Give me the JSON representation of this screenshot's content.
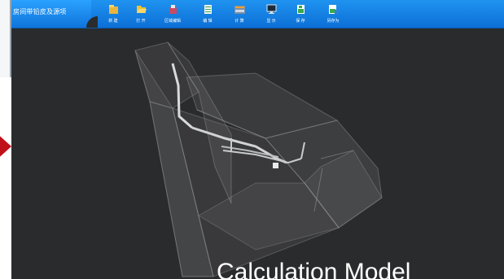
{
  "window": {
    "title": "房间带铅皮及源项"
  },
  "toolbar": {
    "items": [
      {
        "label": "新 建",
        "icon": "new-file-icon",
        "color": "#e8b53a"
      },
      {
        "label": "打 开",
        "icon": "open-folder-icon",
        "color": "#f1c232"
      },
      {
        "label": "区域编辑",
        "icon": "region-edit-icon",
        "color": "#c94a64"
      },
      {
        "label": "编 辑",
        "icon": "edit-sheet-icon",
        "color": "#f4f4f4"
      },
      {
        "label": "计 算",
        "icon": "calculate-icon",
        "color": "#7a8fa8"
      },
      {
        "label": "显 示",
        "icon": "display-monitor-icon",
        "color": "#1c2b3a"
      },
      {
        "label": "保 存",
        "icon": "save-icon",
        "color": "#3aa84a"
      },
      {
        "label": "另存为",
        "icon": "save-as-icon",
        "color": "#3aa84a"
      }
    ]
  },
  "viewport": {
    "caption": "Calculation Model",
    "background": "#2a2b2d"
  },
  "colors": {
    "toolbar": "#0c6fd6",
    "arrow": "#c0101a"
  }
}
